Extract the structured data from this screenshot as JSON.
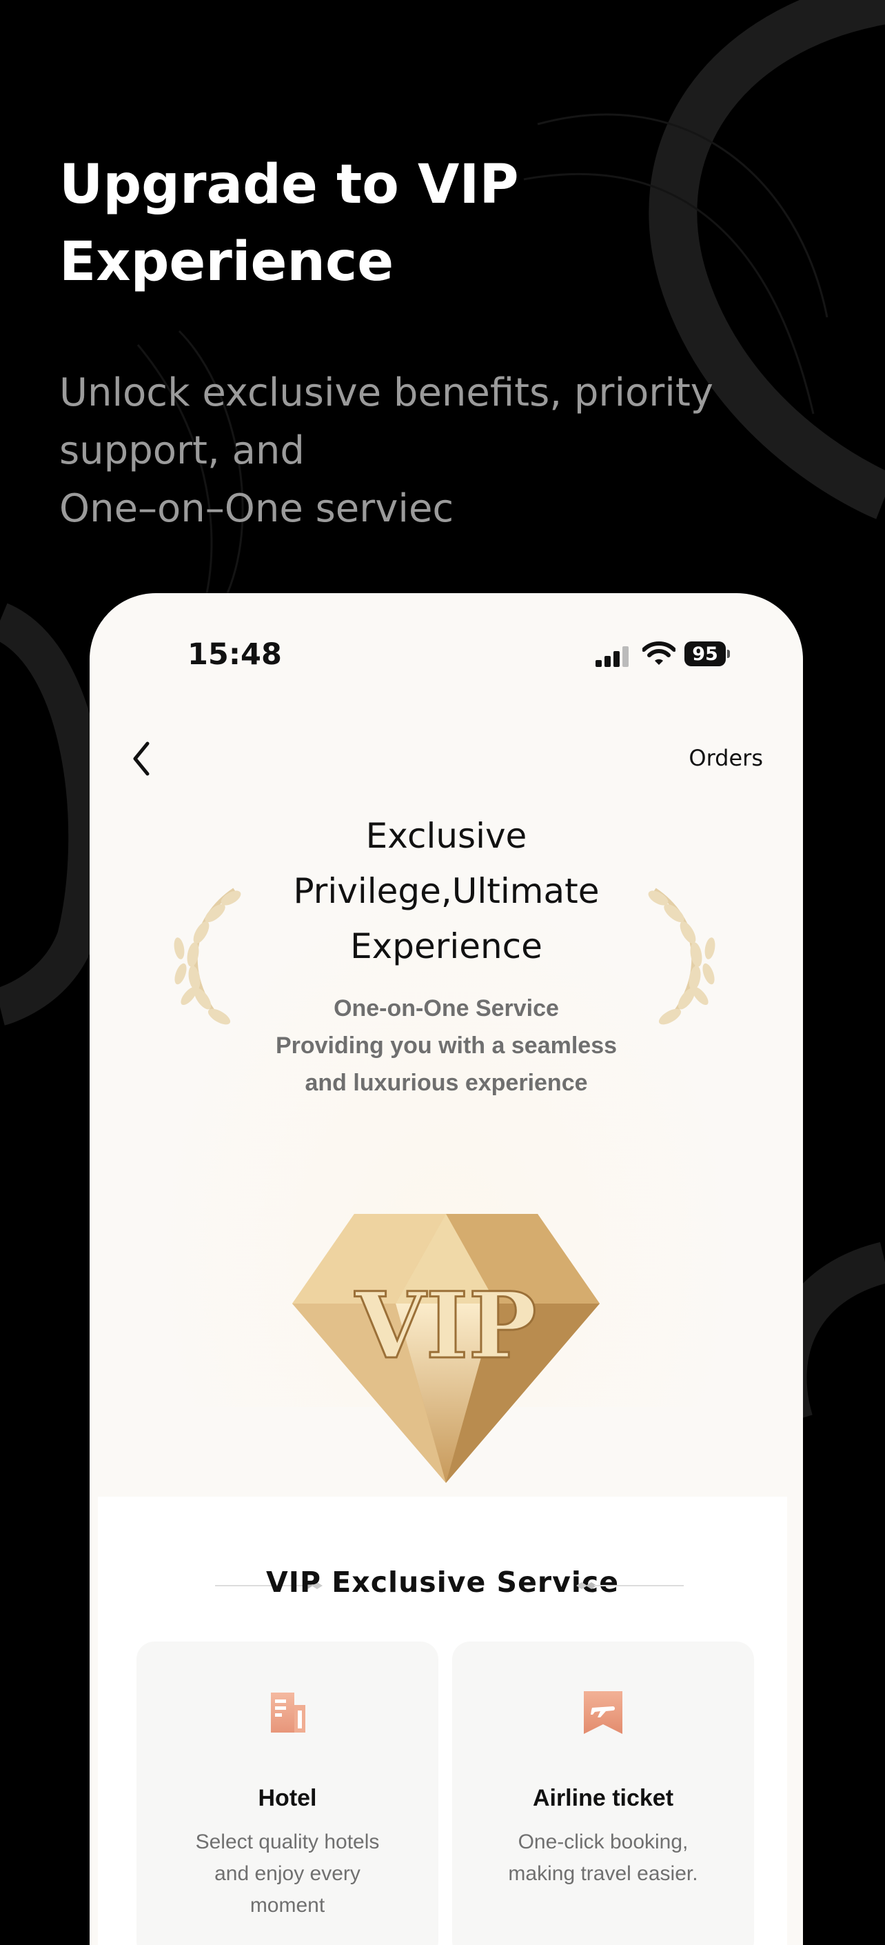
{
  "promo": {
    "title_line1": "Upgrade to VIP",
    "title_line2": "Experience",
    "subtitle": "Unlock exclusive benefits, priority\nsupport, and\nOne–on–One serviec"
  },
  "status_bar": {
    "time": "15:48",
    "battery": "95"
  },
  "nav": {
    "orders_label": "Orders"
  },
  "hero": {
    "title_line1": "Exclusive",
    "title_line2": "Privilege,Ultimate",
    "title_line3": "Experience",
    "subtitle_line1": "One-on-One Service",
    "subtitle_line2": "Providing you with a seamless",
    "subtitle_line3": "and luxurious experience",
    "badge_text": "VIP"
  },
  "services": {
    "section_title": "VIP Exclusive Service",
    "items": [
      {
        "title": "Hotel",
        "desc_line1": "Select quality hotels",
        "desc_line2": "and enjoy every",
        "desc_line3": "moment",
        "icon": "hotel-building-icon"
      },
      {
        "title": "Airline ticket",
        "desc_line1": "One-click booking,",
        "desc_line2": "making travel easier.",
        "icon": "airplane-ticket-icon"
      }
    ]
  },
  "colors": {
    "background": "#000000",
    "phone_bg": "#fbf9f6",
    "gold": "#d8b47c",
    "icon_peach": "#e8a084"
  }
}
